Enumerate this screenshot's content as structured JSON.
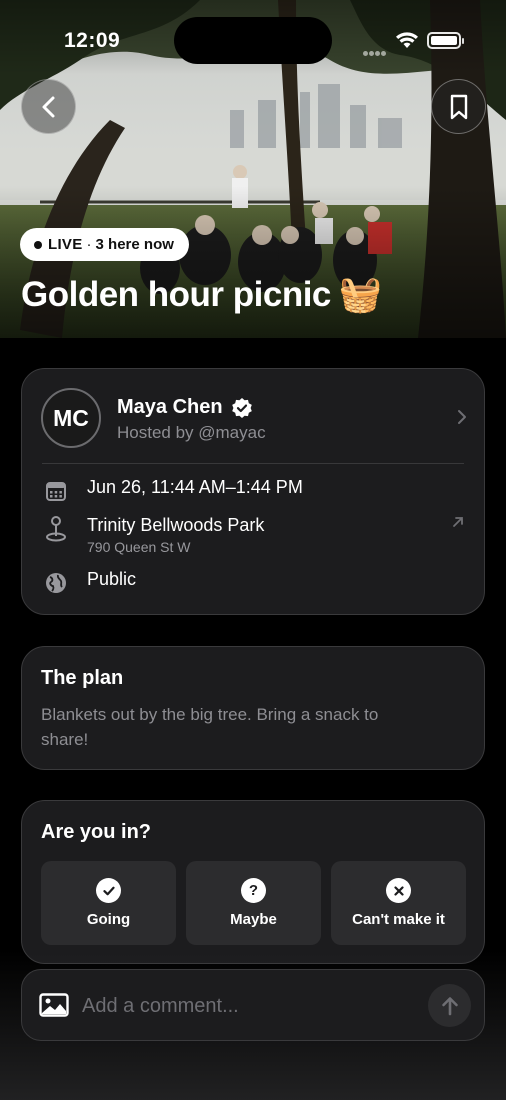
{
  "status_bar": {
    "time": "12:09"
  },
  "hero": {
    "live_label": "LIVE",
    "live_separator": "·",
    "live_count": "3 here now",
    "title": "Golden hour picnic",
    "title_emoji": "🧺"
  },
  "host": {
    "initials": "MC",
    "name": "Maya Chen",
    "subtitle": "Hosted by @mayac",
    "date_time": "Jun 26, 11:44 AM–1:44 PM",
    "location_name": "Trinity Bellwoods Park",
    "location_address": "790 Queen St W",
    "visibility": "Public"
  },
  "plan": {
    "title": "The plan",
    "text": "Blankets out by the big tree. Bring a snack to share!"
  },
  "rsvp": {
    "title": "Are you in?",
    "options": [
      {
        "label": "Going",
        "icon": "check-circle-icon"
      },
      {
        "label": "Maybe",
        "icon": "question-circle-icon"
      },
      {
        "label": "Can't make it",
        "icon": "x-circle-icon"
      }
    ]
  },
  "comment": {
    "placeholder": "Add a comment..."
  }
}
